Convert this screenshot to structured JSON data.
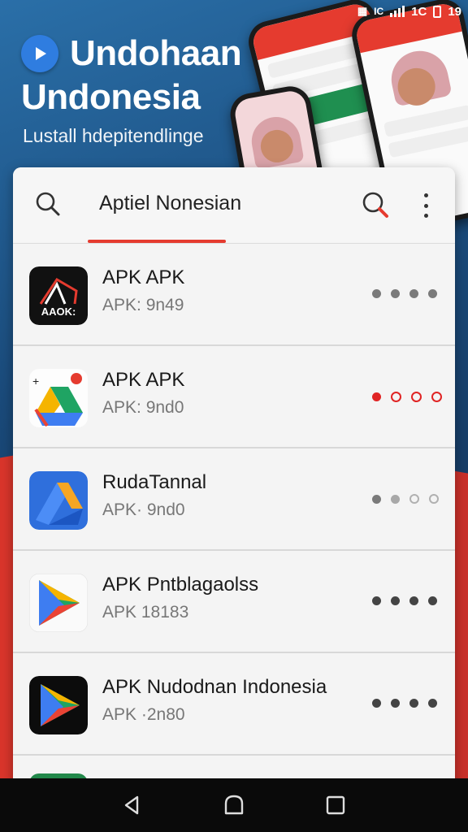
{
  "status_bar": {
    "carrier_label": "IC",
    "network": "1C",
    "battery": "19"
  },
  "hero": {
    "title_line1": "Undohaan",
    "title_line2": "Undonesia",
    "tagline": "Lustall hdepitendlinge"
  },
  "header": {
    "title": "Aptiel Nonesian"
  },
  "apps": [
    {
      "name": "APK APK",
      "sub": "APK: 9n49",
      "icon": "apk-tent-icon",
      "icon_text": "AAOK:"
    },
    {
      "name": "APK APK",
      "sub": "APK: 9nd0",
      "icon": "drive-icon"
    },
    {
      "name": "RudaTannal",
      "sub": "APK· 9nd0",
      "icon": "drive-blue-icon"
    },
    {
      "name": "APK Pntblagaolss",
      "sub": "APK 18183",
      "icon": "play-store-icon"
    },
    {
      "name": "APK Nudodnan Indonesia",
      "sub": "APK ·2n80",
      "icon": "play-store-dark-icon"
    }
  ],
  "colors": {
    "accent": "#e53b2f",
    "hero_bg": "#1a4a7a",
    "card_bg": "#f4f4f4"
  }
}
